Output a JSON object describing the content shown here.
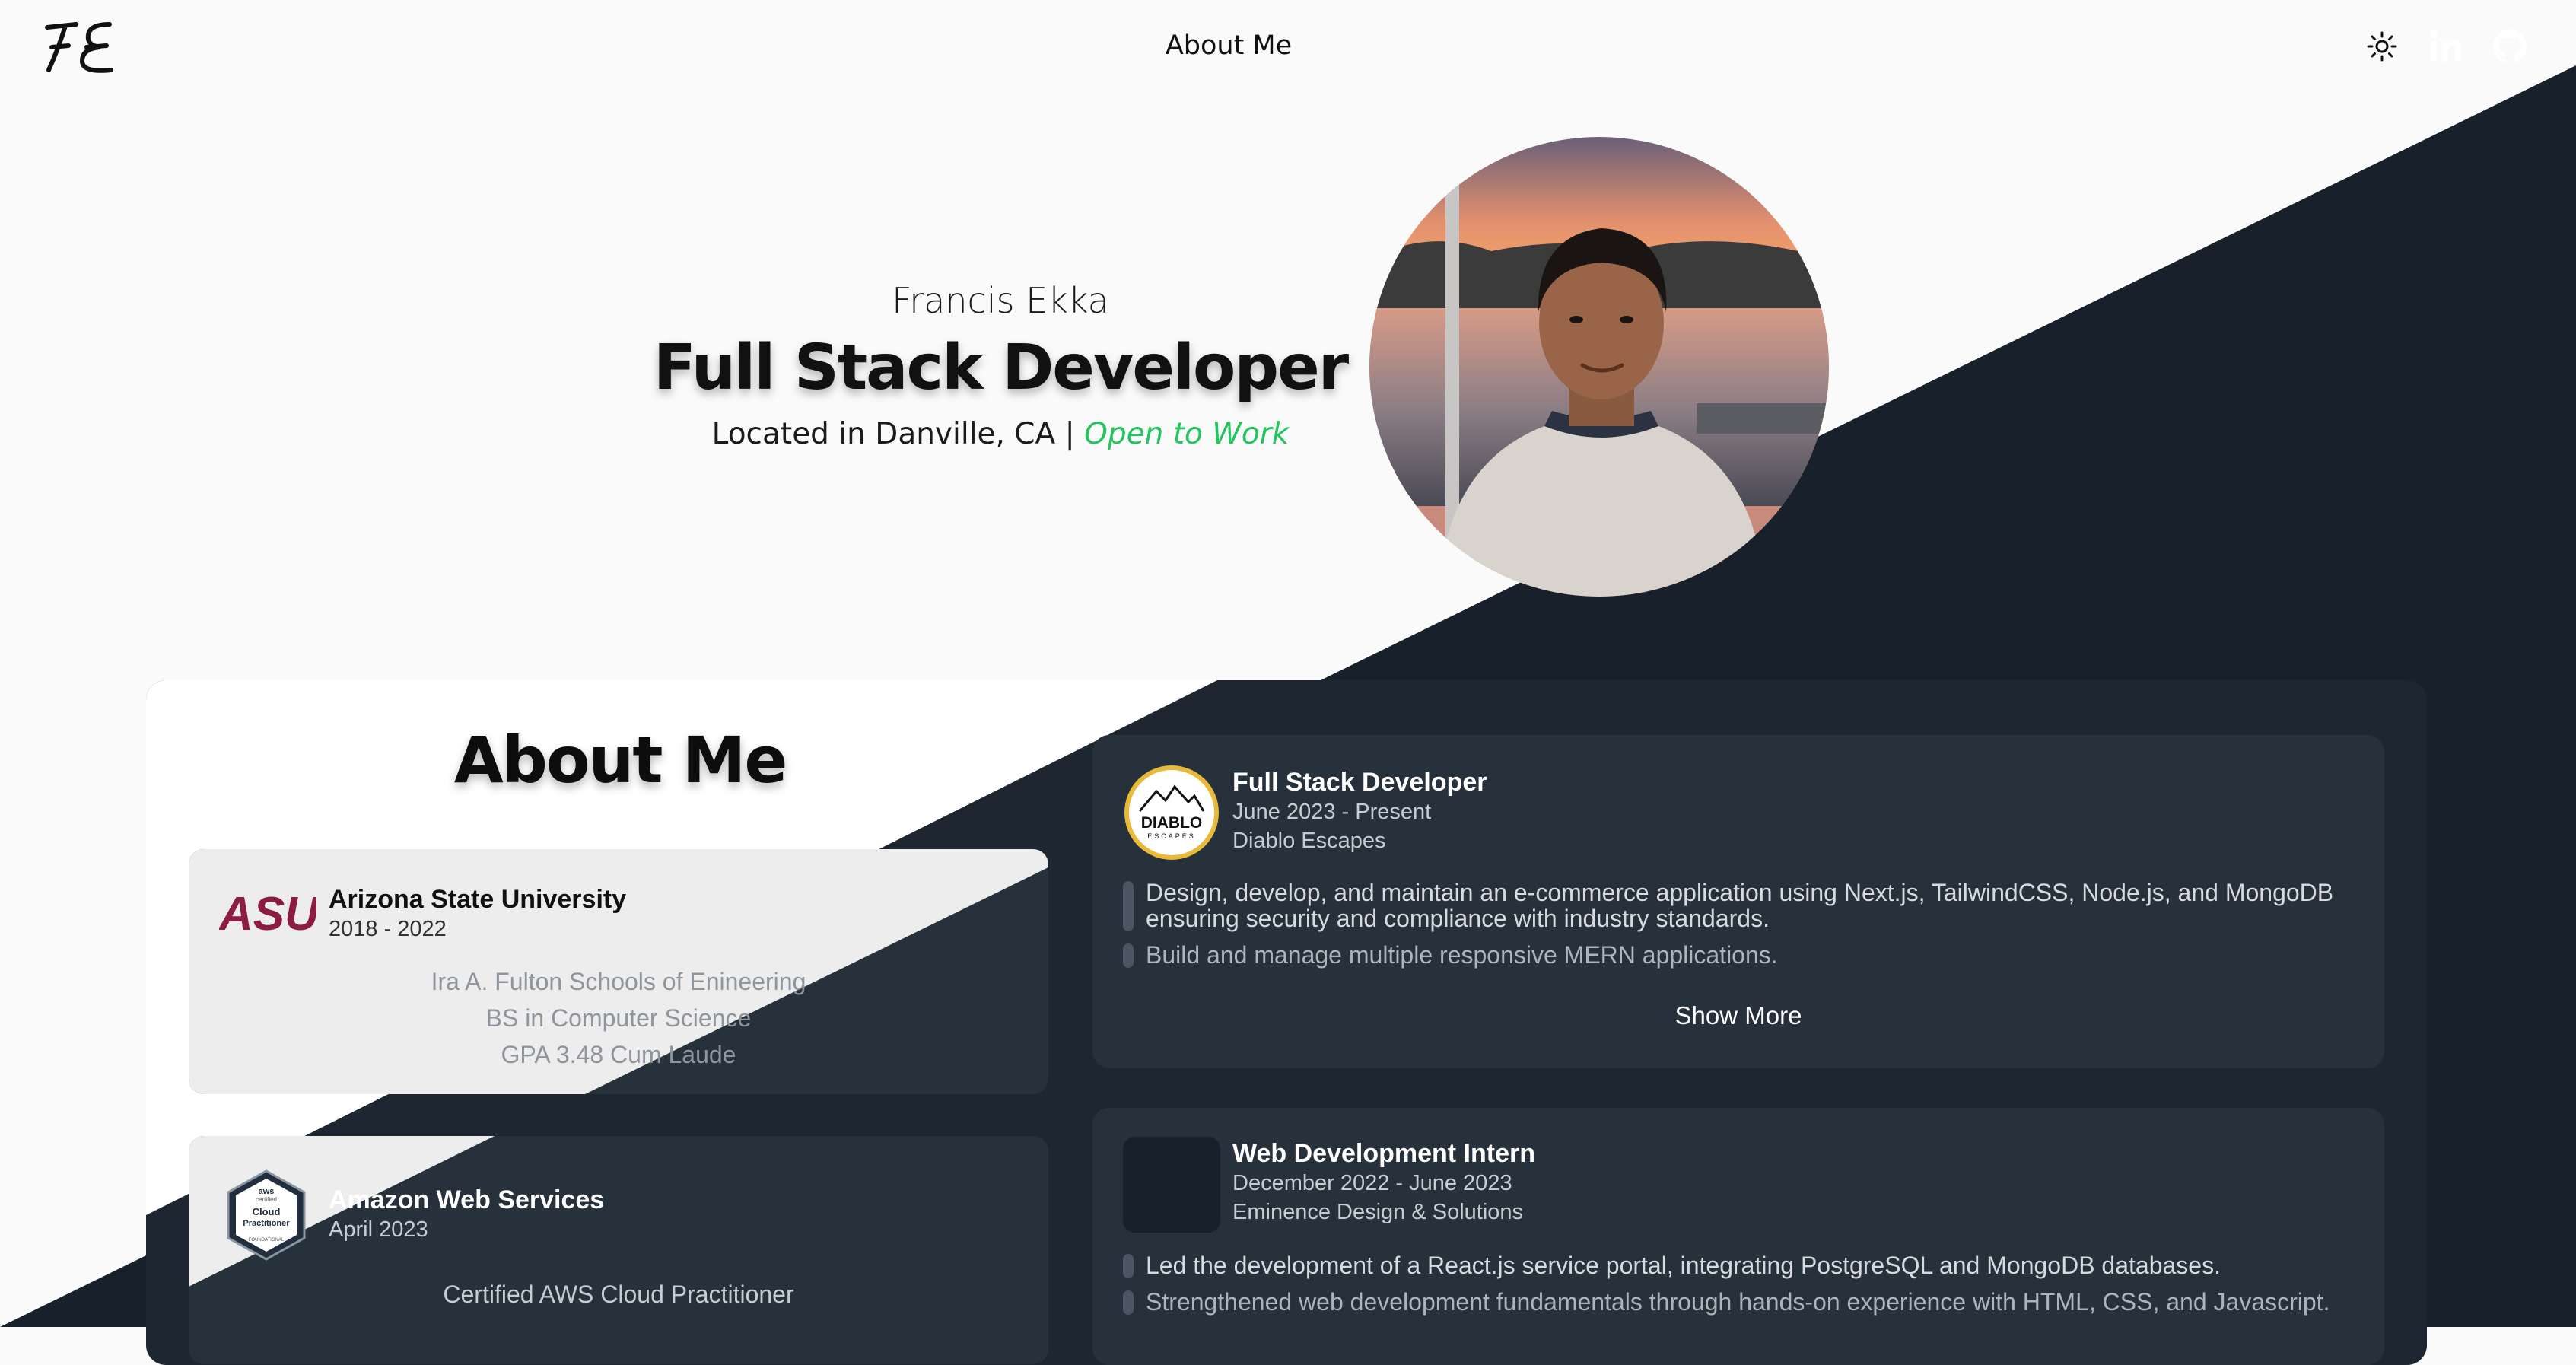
{
  "header": {
    "logo_text": "FE",
    "nav_title": "About Me",
    "icons": [
      "sun-icon",
      "linkedin-icon",
      "github-icon"
    ]
  },
  "hero": {
    "name": "Francis Ekka",
    "title": "Full Stack Developer",
    "location_prefix": "Located in Danville, CA |",
    "status": "Open to Work"
  },
  "about": {
    "heading": "About Me",
    "education": [
      {
        "logo": "ASU",
        "name": "Arizona State University",
        "dates": "2018 - 2022",
        "details": [
          "Ira A. Fulton Schools of Enineering",
          "BS in Computer Science",
          "GPA 3.48 Cum Laude"
        ]
      },
      {
        "logo_lines": [
          "aws",
          "certified",
          "Cloud",
          "Practitioner",
          "FOUNDATIONAL"
        ],
        "name": "Amazon Web Services",
        "dates": "April 2023",
        "details": [
          "Certified AWS Cloud Practitioner"
        ]
      }
    ],
    "experience": [
      {
        "logo": "DIABLO",
        "logo_sub": "ESCAPES",
        "title": "Full Stack Developer",
        "dates": "June 2023 - Present",
        "company": "Diablo Escapes",
        "bullets": [
          "Design, develop, and maintain an e-commerce application using Next.js, TailwindCSS, Node.js, and MongoDB ensuring security and compliance with industry standards.",
          "Build and manage multiple responsive MERN applications."
        ],
        "show_more": "Show More"
      },
      {
        "title": "Web Development Intern",
        "dates": "December 2022 - June 2023",
        "company": "Eminence Design & Solutions",
        "bullets": [
          "Led the development of a React.js service portal, integrating PostgreSQL and MongoDB databases.",
          "Strengthened web development fundamentals through hands-on experience with HTML, CSS, and Javascript."
        ]
      }
    ]
  },
  "colors": {
    "light_bg": "#fafafa",
    "dark_bg": "#17202b",
    "card_dark": "#27313c",
    "card_light": "#ededed",
    "accent_green": "#22c55e",
    "asu_maroon": "#8c1d40",
    "asu_gold": "#ffc627"
  }
}
